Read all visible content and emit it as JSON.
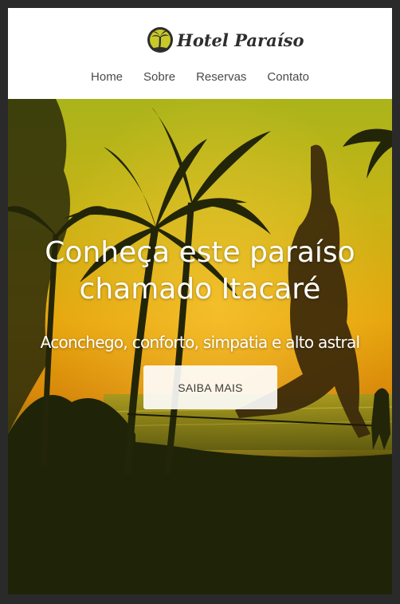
{
  "brand": {
    "name": "Hotel Paraíso",
    "logo_icon": "palm-tree-icon",
    "logo_color": "#c8c82a"
  },
  "nav": {
    "items": [
      {
        "label": "Home"
      },
      {
        "label": "Sobre"
      },
      {
        "label": "Reservas"
      },
      {
        "label": "Contato"
      }
    ]
  },
  "hero": {
    "title_line1": "Conheça este paraíso",
    "title_line2": "chamado Itacaré",
    "subtitle": "Aconchego, conforto, simpatia e alto astral",
    "cta_label": "SAIBA MAIS"
  },
  "colors": {
    "sky_top": "#b8b81c",
    "sky_mid": "#e8a20c",
    "ground": "#1f2408"
  }
}
